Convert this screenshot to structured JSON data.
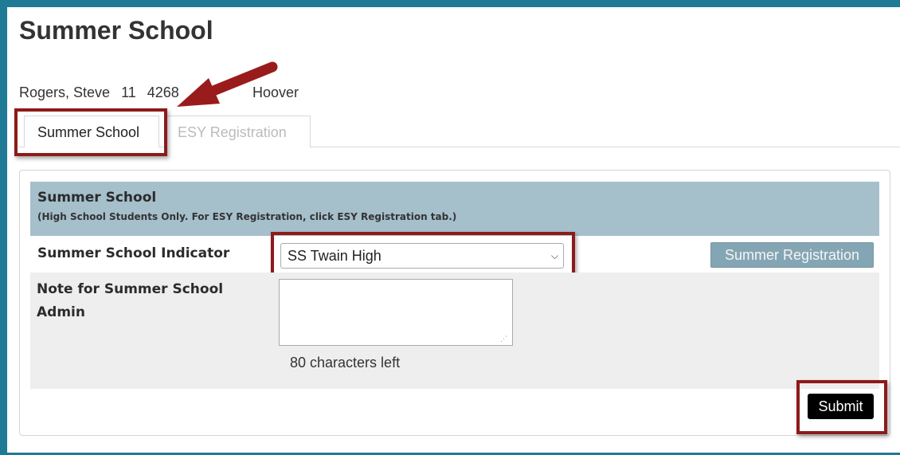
{
  "page": {
    "title": "Summer School"
  },
  "student": {
    "name": "Rogers, Steve",
    "grade": "11",
    "id": "4268",
    "school": "Hoover"
  },
  "tabs": [
    {
      "label": "Summer School",
      "active": true
    },
    {
      "label": "ESY Registration",
      "active": false
    }
  ],
  "section": {
    "title": "Summer School",
    "subtitle": "(High School Students Only. For ESY Registration, click ESY Registration tab.)"
  },
  "indicator": {
    "label": "Summer School Indicator",
    "selected": "SS Twain High"
  },
  "summer_registration_label": "Summer Registration",
  "note": {
    "label_line1": "Note for Summer School",
    "label_line2": "Admin",
    "value": "",
    "chars_left": "80 characters left"
  },
  "submit_label": "Submit",
  "colors": {
    "frame": "#1f7a96",
    "section_header": "#a5bfcb",
    "highlight": "#8e1a1a",
    "summer_reg_button": "#84a6b4",
    "submit_button": "#000000"
  }
}
